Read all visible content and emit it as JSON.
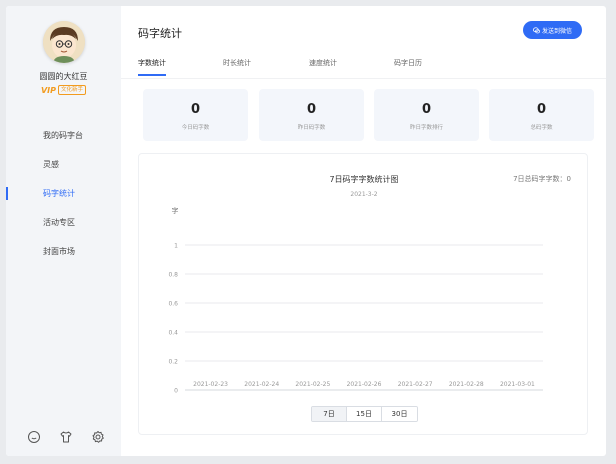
{
  "user": {
    "name": "圆圆的大红豆",
    "vip_label": "VIP",
    "badge": "文化新手"
  },
  "nav": [
    {
      "label": "我的码字台",
      "active": false
    },
    {
      "label": "灵感",
      "active": false
    },
    {
      "label": "码字统计",
      "active": true
    },
    {
      "label": "活动专区",
      "active": false
    },
    {
      "label": "封面市场",
      "active": false
    }
  ],
  "footer_icons": [
    "smile-icon",
    "shirt-icon",
    "settings-icon"
  ],
  "header": {
    "title": "码字统计",
    "send_button": "发送到微信"
  },
  "tabs": [
    {
      "label": "字数统计",
      "active": true
    },
    {
      "label": "时长统计",
      "active": false
    },
    {
      "label": "速度统计",
      "active": false
    },
    {
      "label": "码字日历",
      "active": false
    }
  ],
  "stats": [
    {
      "value": "0",
      "label": "今日码字数"
    },
    {
      "value": "0",
      "label": "昨日码字数"
    },
    {
      "value": "0",
      "label": "昨日字数排行"
    },
    {
      "value": "0",
      "label": "总码字数"
    }
  ],
  "chart_data": {
    "type": "line",
    "title": "7日码字字数统计图",
    "subtitle": "2021-3-2",
    "total_label": "7日总码字字数：0",
    "ylabel": "字",
    "xlabel": "",
    "categories": [
      "2021-02-23",
      "2021-02-24",
      "2021-02-25",
      "2021-02-26",
      "2021-02-27",
      "2021-02-28",
      "2021-03-01"
    ],
    "series": [
      {
        "values": [
          0,
          0,
          0,
          0,
          0,
          0,
          0
        ]
      }
    ],
    "ylim": [
      0,
      1
    ],
    "yticks": [
      "0",
      "0.2",
      "0.4",
      "0.6",
      "0.8",
      "1"
    ],
    "grid": true
  },
  "range_buttons": [
    {
      "label": "7日",
      "active": true
    },
    {
      "label": "15日",
      "active": false
    },
    {
      "label": "30日",
      "active": false
    }
  ],
  "colors": {
    "accent": "#2f6bf5",
    "vip": "#f29b1e",
    "sidebar_bg": "#f3f5f8",
    "stat_bg": "#f3f6fb"
  }
}
